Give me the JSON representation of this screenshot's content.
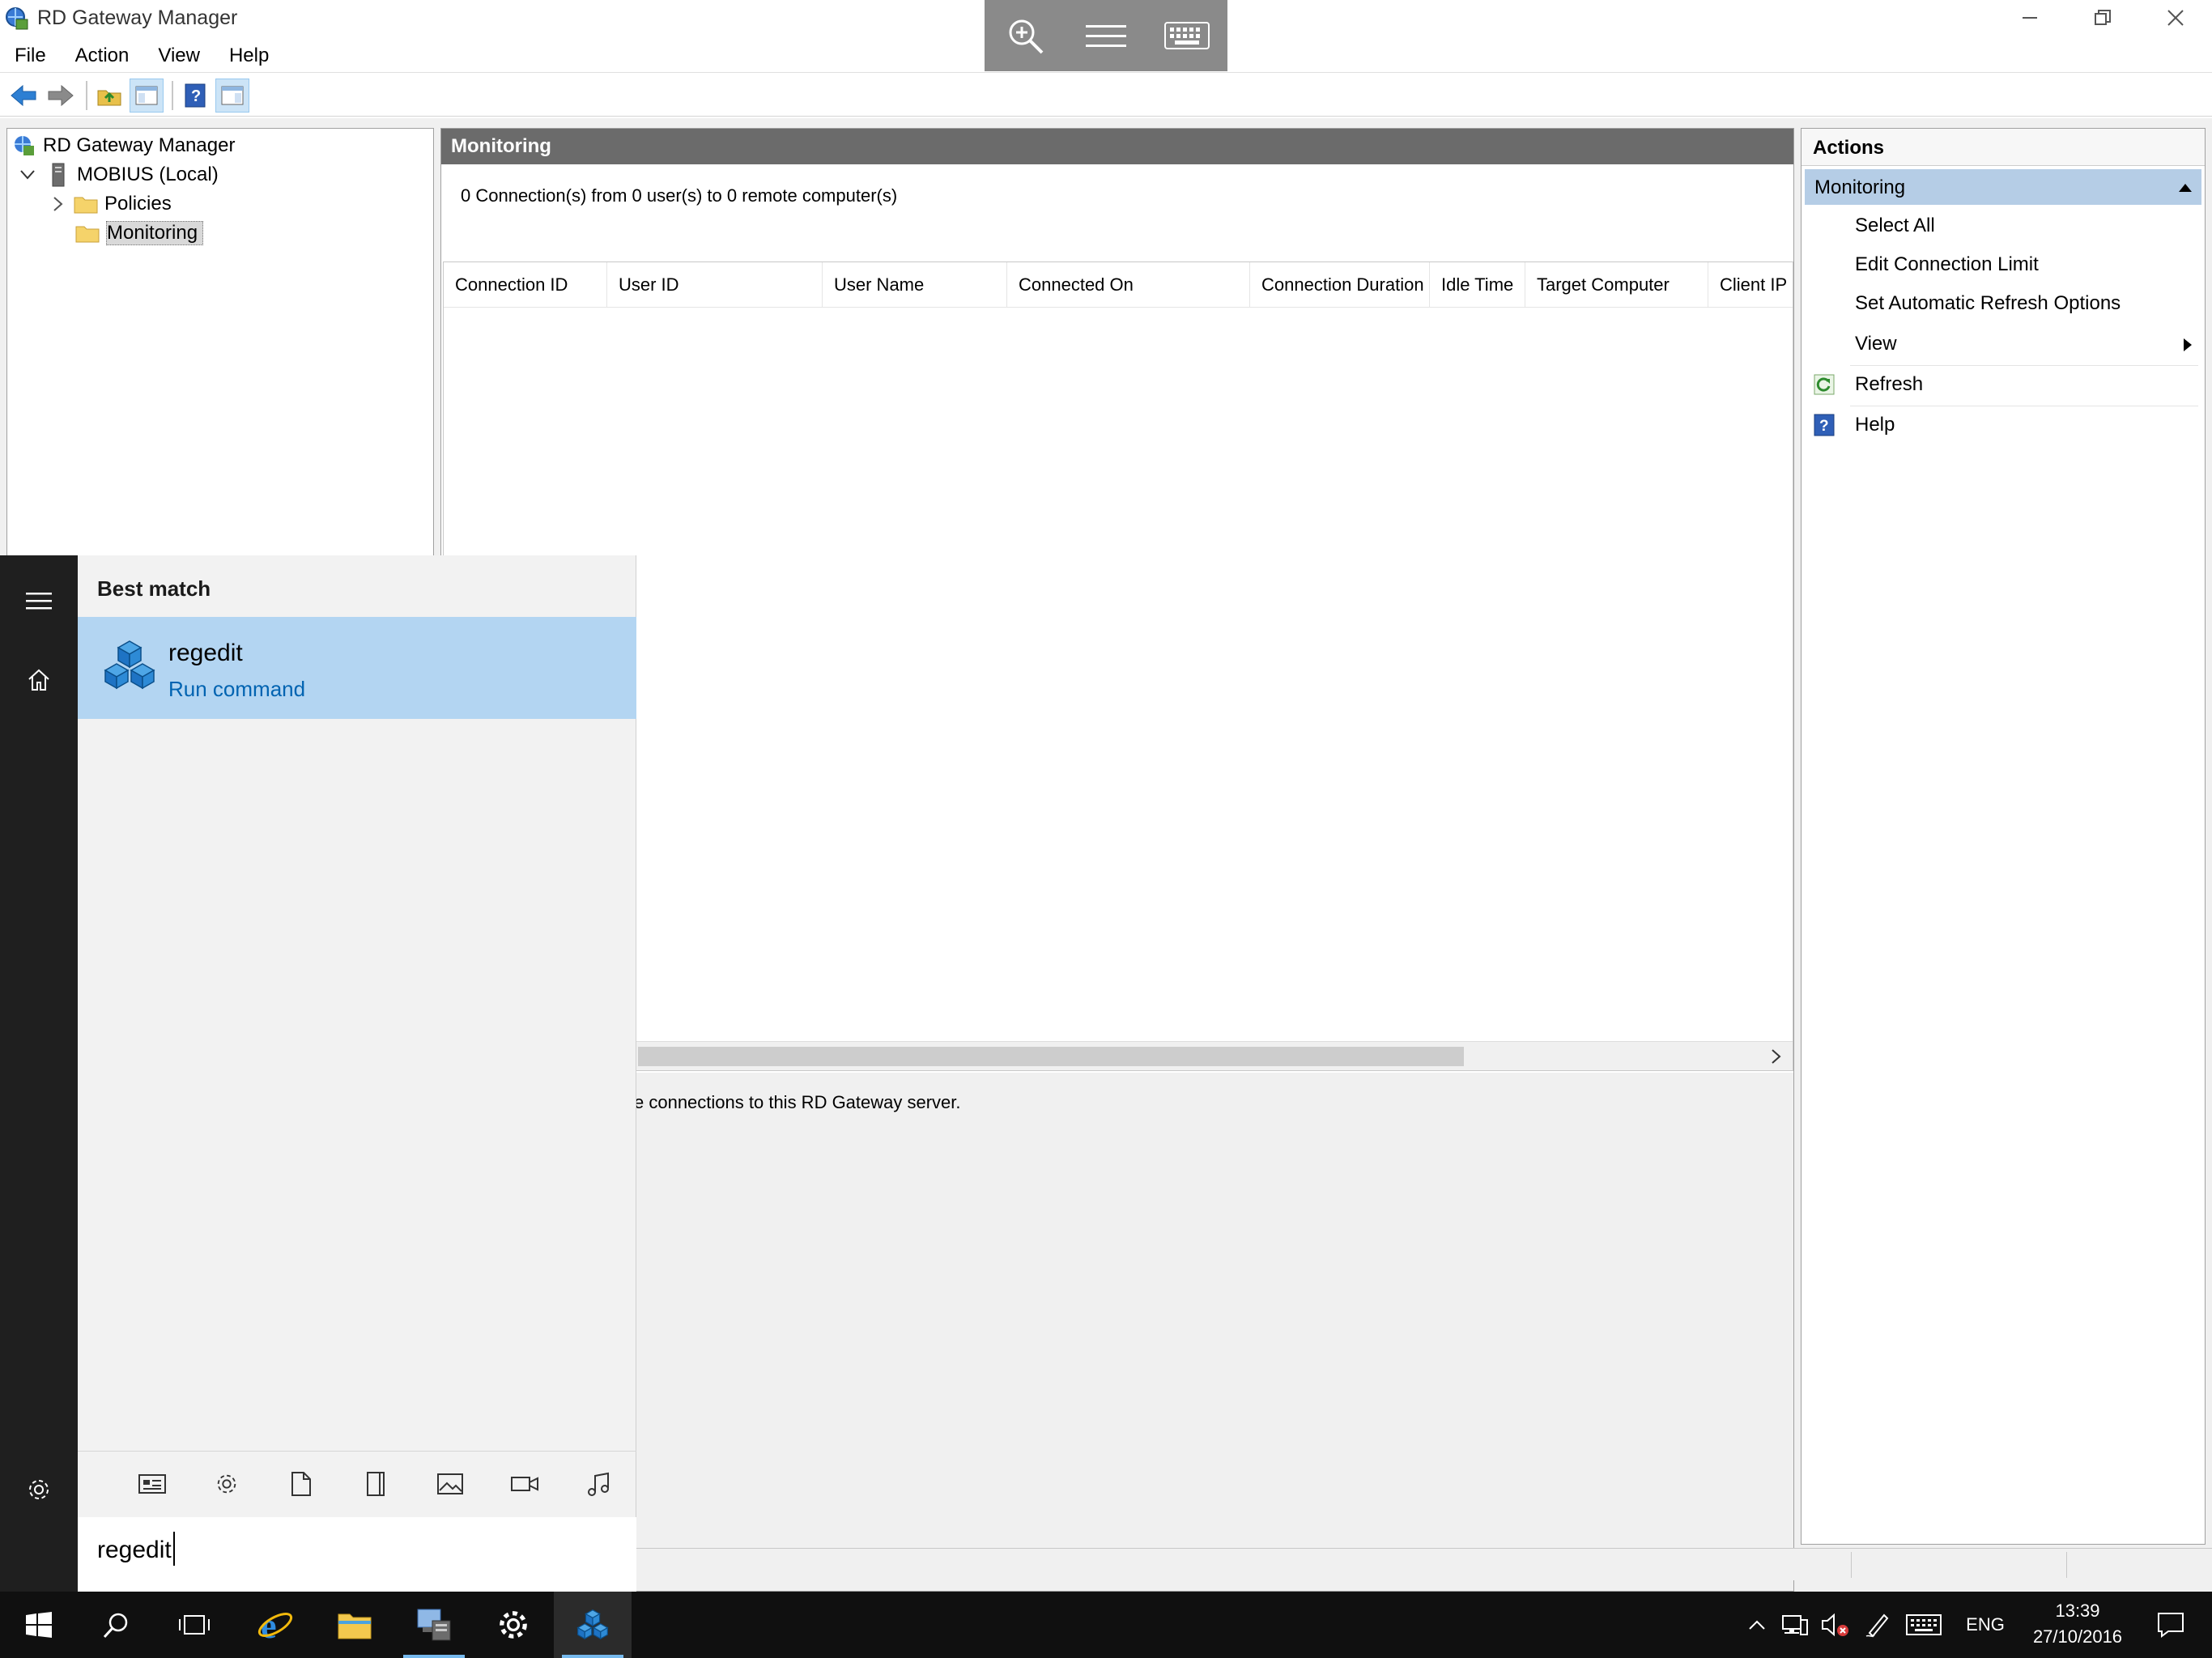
{
  "window": {
    "title": "RD Gateway Manager"
  },
  "menu": [
    "File",
    "Action",
    "View",
    "Help"
  ],
  "tree": {
    "root": "RD Gateway Manager",
    "server": "MOBIUS (Local)",
    "policies": "Policies",
    "monitoring": "Monitoring"
  },
  "center": {
    "header": "Monitoring",
    "summary": "0 Connection(s) from 0 user(s) to 0 remote computer(s)",
    "columns": [
      "Connection ID",
      "User ID",
      "User Name",
      "Connected On",
      "Connection Duration",
      "Idle Time",
      "Target Computer",
      "Client IP ..."
    ],
    "description": "e connections to this RD Gateway server."
  },
  "actions": {
    "header": "Actions",
    "group": "Monitoring",
    "items": {
      "select_all": "Select All",
      "edit_limit": "Edit Connection Limit",
      "refresh_options": "Set Automatic Refresh Options",
      "view": "View",
      "refresh": "Refresh",
      "help": "Help"
    }
  },
  "start_menu": {
    "best_match": "Best match",
    "result_name": "regedit",
    "result_sub": "Run command",
    "search_value": "regedit"
  },
  "taskbar": {
    "language": "ENG",
    "time": "13:39",
    "date": "27/10/2016"
  },
  "colors": {
    "accent": "#0063b1",
    "selection": "#b3d5f2",
    "action_group": "#b5cde6",
    "pane_header": "#6b6b6b",
    "taskbar": "#101010"
  }
}
